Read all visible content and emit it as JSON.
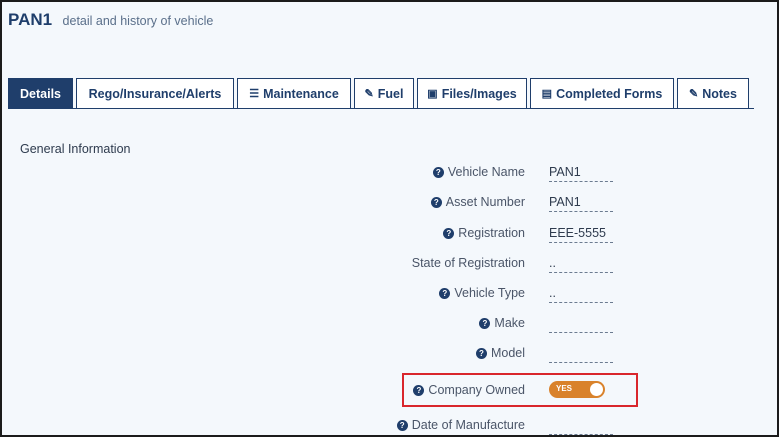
{
  "header": {
    "title": "PAN1",
    "subtitle": "detail and history of vehicle"
  },
  "tabs": [
    {
      "label": "Details",
      "icon": "",
      "active": true
    },
    {
      "label": "Rego/Insurance/Alerts",
      "icon": ""
    },
    {
      "label": "Maintenance",
      "icon": "list-icon"
    },
    {
      "label": "Fuel",
      "icon": "pencil-icon"
    },
    {
      "label": "Files/Images",
      "icon": "file-image-icon"
    },
    {
      "label": "Completed Forms",
      "icon": "form-icon"
    },
    {
      "label": "Notes",
      "icon": "pencil-icon"
    }
  ],
  "section": {
    "title": "General Information"
  },
  "fields": [
    {
      "label": "Vehicle Name",
      "value": "PAN1",
      "help": true
    },
    {
      "label": "Asset Number",
      "value": "PAN1",
      "help": true
    },
    {
      "label": "Registration",
      "value": "EEE-5555",
      "help": true
    },
    {
      "label": "State of Registration",
      "value": "..",
      "help": false
    },
    {
      "label": "Vehicle Type",
      "value": "..",
      "help": true
    },
    {
      "label": "Make",
      "value": "",
      "help": true
    },
    {
      "label": "Model",
      "value": "",
      "help": true
    },
    {
      "label": "Company Owned",
      "value": "YES",
      "help": true
    },
    {
      "label": "Date of Manufacture",
      "value": "",
      "help": true
    }
  ],
  "colors": {
    "brand": "#1f3e6b",
    "toggle_on": "#d9822b",
    "highlight": "#d9262c"
  }
}
